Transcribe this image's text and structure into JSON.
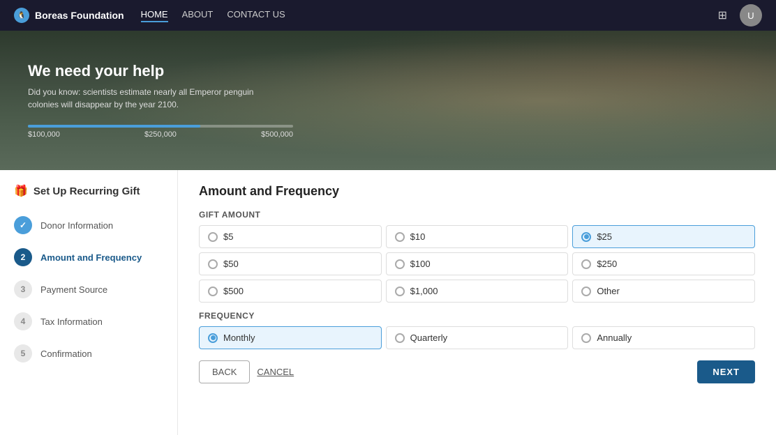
{
  "nav": {
    "logo_text": "Boreas Foundation",
    "links": [
      {
        "label": "HOME",
        "active": true
      },
      {
        "label": "ABOUT",
        "active": false
      },
      {
        "label": "CONTACT US",
        "active": false
      }
    ],
    "avatar_initials": "U"
  },
  "hero": {
    "title": "We need your help",
    "subtitle": "Did you know: scientists estimate nearly all Emperor penguin colonies will disappear by the year 2100.",
    "progress_labels": [
      "$100,000",
      "$250,000",
      "$500,000"
    ]
  },
  "sidebar": {
    "header": "Set Up Recurring Gift",
    "steps": [
      {
        "number": "✓",
        "label": "Donor Information",
        "state": "done"
      },
      {
        "number": "2",
        "label": "Amount and Frequency",
        "state": "active"
      },
      {
        "number": "3",
        "label": "Payment Source",
        "state": "inactive"
      },
      {
        "number": "4",
        "label": "Tax Information",
        "state": "inactive"
      },
      {
        "number": "5",
        "label": "Confirmation",
        "state": "inactive"
      }
    ]
  },
  "content": {
    "title": "Amount and Frequency",
    "gift_amount_label": "Gift Amount",
    "amounts": [
      {
        "value": "$5",
        "selected": false
      },
      {
        "value": "$10",
        "selected": false
      },
      {
        "value": "$25",
        "selected": true
      },
      {
        "value": "$50",
        "selected": false
      },
      {
        "value": "$100",
        "selected": false
      },
      {
        "value": "$250",
        "selected": false
      },
      {
        "value": "$500",
        "selected": false
      },
      {
        "value": "$1,000",
        "selected": false
      },
      {
        "value": "Other",
        "selected": false
      }
    ],
    "frequency_label": "Frequency",
    "frequencies": [
      {
        "value": "Monthly",
        "selected": true
      },
      {
        "value": "Quarterly",
        "selected": false
      },
      {
        "value": "Annually",
        "selected": false
      }
    ],
    "buttons": {
      "back": "BACK",
      "cancel": "CANCEL",
      "next": "NEXT"
    }
  }
}
